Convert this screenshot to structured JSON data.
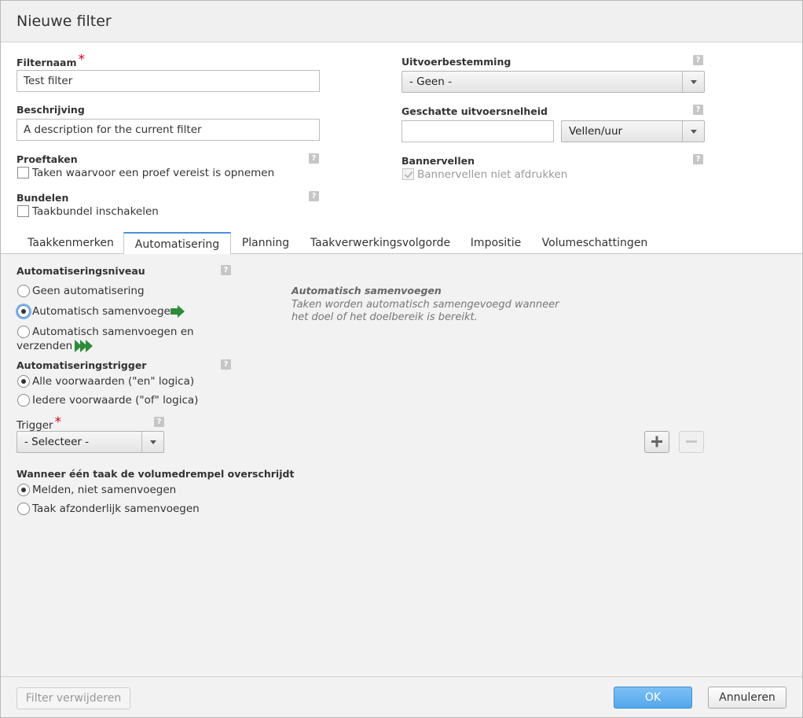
{
  "dialog": {
    "title": "Nieuwe filter"
  },
  "general": {
    "filter_name_label": "Filternaam",
    "required_mark": "*",
    "filter_name_value": "Test filter",
    "description_label": "Beschrijving",
    "description_value": "A description for the current filter",
    "proof_label": "Proeftaken",
    "proof_checkbox": "Taken waarvoor een proef vereist is opnemen",
    "bundle_label": "Bundelen",
    "bundle_checkbox": "Taakbundel inschakelen",
    "output_label": "Uitvoerbestemming",
    "output_value": "- Geen -",
    "speed_label": "Geschatte uitvoersnelheid",
    "speed_value": "",
    "speed_unit": "Vellen/uur",
    "banner_label": "Bannervellen",
    "banner_checkbox": "Bannervellen niet afdrukken",
    "help_glyph": "?"
  },
  "tabs": [
    {
      "label": "Taakkenmerken"
    },
    {
      "label": "Automatisering",
      "active": true
    },
    {
      "label": "Planning"
    },
    {
      "label": "Taakverwerkingsvolgorde"
    },
    {
      "label": "Impositie"
    },
    {
      "label": "Volumeschattingen"
    }
  ],
  "automation": {
    "level_label": "Automatiseringsniveau",
    "level_options": [
      {
        "label": "Geen automatisering",
        "selected": false
      },
      {
        "label": "Automatisch samenvoegen",
        "selected": true,
        "icon": "arrow-right-icon"
      },
      {
        "label_line1": "Automatisch samenvoegen en",
        "label_line2": "verzenden",
        "selected": false,
        "icon": "double-arrow-right-icon"
      }
    ],
    "info_title": "Automatisch samenvoegen",
    "info_line1": "Taken worden automatisch samengevoegd wanneer",
    "info_line2": "het doel of het doelbereik is bereikt.",
    "trigger_mode_label": "Automatiseringstrigger",
    "trigger_modes": [
      {
        "label": "Alle voorwaarden (\"en\" logica)",
        "selected": true
      },
      {
        "label": "Iedere voorwaarde (\"of\" logica)",
        "selected": false
      }
    ],
    "trigger_label": "Trigger",
    "trigger_value": "- Selecteer -",
    "threshold_label": "Wanneer één taak de volumedrempel overschrijdt",
    "threshold_options": [
      {
        "label": "Melden, niet samenvoegen",
        "selected": true
      },
      {
        "label": "Taak afzonderlijk samenvoegen",
        "selected": false
      }
    ]
  },
  "footer": {
    "delete_label": "Filter verwijderen",
    "ok_label": "OK",
    "cancel_label": "Annuleren"
  },
  "colors": {
    "accent": "#4a90d9",
    "ok_button": "#5aaaed",
    "arrow_green": "#2e8b3a",
    "required": "#d0021b"
  }
}
